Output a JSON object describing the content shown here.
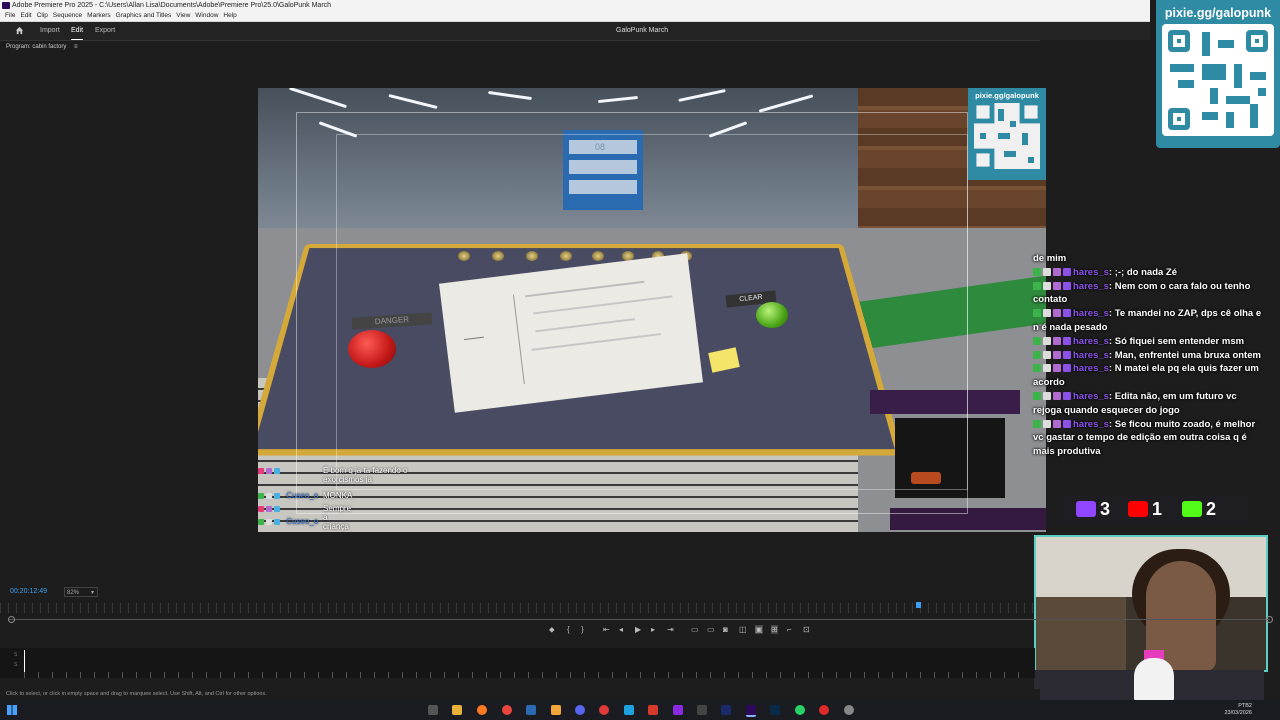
{
  "window": {
    "title": "Adobe Premiere Pro 2025 - C:\\Users\\Allan Lisa\\Documents\\Adobe\\Premiere Pro\\25.0\\GaloPunk March",
    "menu": [
      "File",
      "Edit",
      "Clip",
      "Sequence",
      "Markers",
      "Graphics and Titles",
      "View",
      "Window",
      "Help"
    ]
  },
  "workspace": {
    "tabs": [
      "Import",
      "Edit",
      "Export"
    ],
    "active_tab": "Edit",
    "project_name": "GaloPunk March",
    "program_label": "Program: cabin factory"
  },
  "game": {
    "danger_label": "DANGER",
    "clear_label": "CLEAR",
    "panel_number": "08"
  },
  "video_chat": [
    {
      "user": "",
      "text": "É bom q ja ta fazendo o exorcismos ja"
    },
    {
      "user": "Cuseo_o",
      "text": "MONKA"
    },
    {
      "user": "",
      "text": "Sempre a criança"
    },
    {
      "user": "Cuseo_o",
      "text": ""
    }
  ],
  "overlay_chat": [
    {
      "user": "",
      "text": "de mim"
    },
    {
      "user": "hares_s",
      "text": ";-; do nada Zé"
    },
    {
      "user": "hares_s",
      "text": "Nem com o cara falo ou tenho contato"
    },
    {
      "user": "hares_s",
      "text": "Te mandei no ZAP, dps cê olha e n é nada pesado"
    },
    {
      "user": "hares_s",
      "text": "Só fiquei sem entender msm"
    },
    {
      "user": "hares_s",
      "text": "Man, enfrentei uma bruxa ontem"
    },
    {
      "user": "hares_s",
      "text": "N matei ela pq ela quis fazer um acordo"
    },
    {
      "user": "hares_s",
      "text": "Edita não, em um futuro vc rejoga quando esquecer do jogo"
    },
    {
      "user": "hares_s",
      "text": "Se ficou muito zoado, é melhor vc gastar o tempo de edição em outra coisa q é mais produtiva"
    }
  ],
  "qr_big_url": "pixie.gg/galopunk",
  "qr_small_url": "pixie.gg/galopunk",
  "socials": {
    "twitch": "3",
    "youtube": "1",
    "kick": "2",
    "colors": {
      "twitch": "#9146ff",
      "youtube": "#ff0000",
      "kick": "#53fc18"
    }
  },
  "playback": {
    "timecode": "00:20:12:49",
    "zoom": "82%",
    "playhead_fraction": 0.89
  },
  "status_text": "Click to select, or click in empty space and drag to marquee select. Use Shift, Alt, and Ctrl for other options.",
  "clock": {
    "time": "PTB2",
    "date": "23/03/2026"
  },
  "colors": {
    "accent": "#3ba0f5",
    "chat_name": "#8a52e8",
    "qr_bg": "#2f8aa3"
  }
}
